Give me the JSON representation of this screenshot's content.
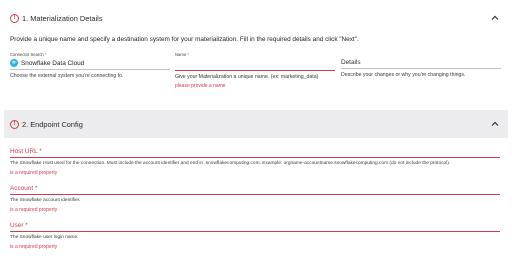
{
  "section1": {
    "number_title": "1. Materialization Details",
    "intro": "Provide a unique name and specify a destination system for your materialization. Fill in the required details and click \"Next\".",
    "connector": {
      "label": "Connector Search",
      "required_mark": "*",
      "value": "Snowflake Data Cloud",
      "helper": "Choose the external system you're connecting to."
    },
    "name": {
      "label": "Name",
      "required_mark": "*",
      "value": "",
      "helper": "Give your Materialization a unique name. (ex: marketing_data)",
      "error": "please provide a name"
    },
    "details": {
      "placeholder": "Details",
      "helper": "Describe your changes or why you're changing things."
    }
  },
  "section2": {
    "number_title": "2. Endpoint Config",
    "host": {
      "label": "Host URL",
      "required_mark": "*",
      "helper": "The Snowflake Host used for the connection. Must include the account identifier and end in .snowflakecomputing.com. Example: orgname-accountname.snowflakecomputing.com (do not include the protocol).",
      "error": "is a required property"
    },
    "account": {
      "label": "Account",
      "required_mark": "*",
      "helper": "The Snowflake account identifier.",
      "error": "is a required property"
    },
    "user": {
      "label": "User",
      "required_mark": "*",
      "helper": "The Snowflake user login name.",
      "error": "is a required property"
    }
  },
  "colors": {
    "error": "#d33b4b",
    "header_bg": "#ececee",
    "snowflake": "#29b5e8"
  },
  "icons": {
    "warning": "warning-circle-icon",
    "collapse": "chevron-up-icon",
    "logo": "snowflake-logo-icon"
  }
}
